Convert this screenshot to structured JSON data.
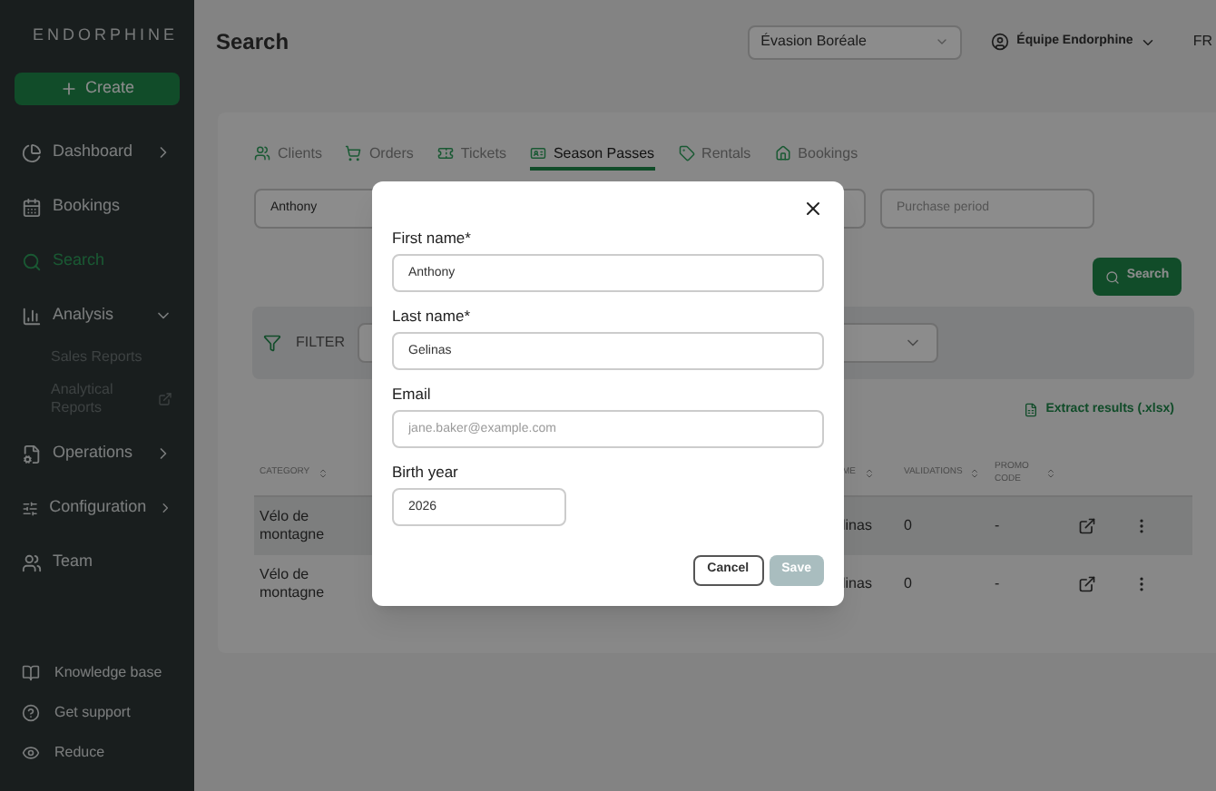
{
  "brand": {
    "name": "ENDORPHINE"
  },
  "create_button": {
    "label": "Create"
  },
  "sidebar": {
    "items": [
      {
        "label": "Dashboard",
        "selected": false,
        "kind": "group",
        "expanded": false
      },
      {
        "label": "Bookings",
        "selected": false,
        "kind": "link"
      },
      {
        "label": "Search",
        "selected": true,
        "kind": "link"
      },
      {
        "label": "Analysis",
        "selected": false,
        "kind": "group",
        "expanded": true,
        "children": [
          {
            "label": "Sales Reports",
            "external": false
          },
          {
            "label": "Analytical Reports",
            "external": true
          }
        ]
      },
      {
        "label": "Operations",
        "selected": false,
        "kind": "group",
        "expanded": false
      },
      {
        "label": "Configuration",
        "selected": false,
        "kind": "group",
        "expanded": false
      },
      {
        "label": "Team",
        "selected": false,
        "kind": "link"
      }
    ],
    "footer": [
      {
        "label": "Knowledge base"
      },
      {
        "label": "Get support"
      },
      {
        "label": "Reduce"
      }
    ]
  },
  "header": {
    "title": "Search",
    "organization": "Évasion Boréale",
    "user": "Équipe Endorphine",
    "language": "FR"
  },
  "tabs": [
    {
      "label": "Clients",
      "selected": false
    },
    {
      "label": "Orders",
      "selected": false
    },
    {
      "label": "Tickets",
      "selected": false
    },
    {
      "label": "Season Passes",
      "selected": true
    },
    {
      "label": "Rentals",
      "selected": false
    },
    {
      "label": "Bookings",
      "selected": false
    }
  ],
  "search_fields": {
    "first_name": "Anthony",
    "purchase_period_placeholder": "Purchase period"
  },
  "search_button": {
    "label": "Search"
  },
  "filter": {
    "label": "FILTER"
  },
  "extract_link": {
    "label": "Extract results (.xlsx)"
  },
  "table": {
    "columns": [
      "CATEGORY",
      "ME",
      "VALIDATIONS",
      "PROMO CODE"
    ],
    "rows": [
      {
        "category": "Vélo de montagne",
        "name": "linas",
        "validations": "0",
        "promo_code": "-"
      },
      {
        "category": "Vélo de montagne",
        "name": "linas",
        "validations": "0",
        "promo_code": "-"
      }
    ]
  },
  "dialog": {
    "fields": [
      {
        "label": "First name*",
        "value": "Anthony",
        "kind": "text"
      },
      {
        "label": "Last name*",
        "value": "Gelinas",
        "kind": "text"
      },
      {
        "label": "Email",
        "placeholder": "jane.baker@example.com",
        "kind": "text"
      },
      {
        "label": "Birth year",
        "value": "2026",
        "kind": "year"
      }
    ],
    "buttons": [
      {
        "label": "Cancel",
        "kind": "secondary",
        "disabled": false
      },
      {
        "label": "Save",
        "kind": "primary",
        "disabled": true
      }
    ]
  }
}
